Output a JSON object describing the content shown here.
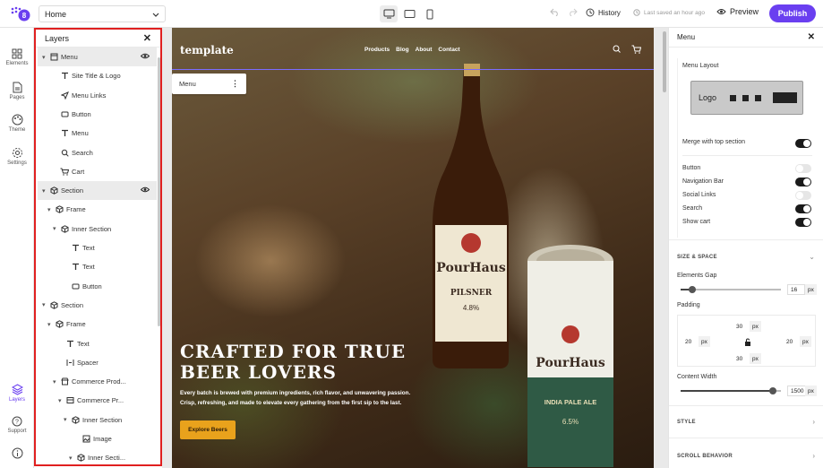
{
  "topbar": {
    "page_selector": "Home",
    "history_label": "History",
    "saved_status": "Last saved an hour ago",
    "preview_label": "Preview",
    "publish_label": "Publish",
    "accent_color": "#6a3ff0"
  },
  "rail": {
    "items": [
      {
        "label": "Elements",
        "icon": "grid-icon"
      },
      {
        "label": "Pages",
        "icon": "document-icon"
      },
      {
        "label": "Theme",
        "icon": "palette-icon"
      },
      {
        "label": "Settings",
        "icon": "gear-icon"
      },
      {
        "label": "Layers",
        "icon": "layers-icon"
      },
      {
        "label": "Support",
        "icon": "help-icon"
      }
    ]
  },
  "layers": {
    "title": "Layers",
    "items": [
      {
        "label": "Menu",
        "icon": "menu-box-icon",
        "chevron": "▾",
        "highlight": true,
        "eye": true
      },
      {
        "label": "Site Title & Logo",
        "icon": "text-icon"
      },
      {
        "label": "Menu Links",
        "icon": "send-icon"
      },
      {
        "label": "Button",
        "icon": "button-icon"
      },
      {
        "label": "Menu",
        "icon": "text-icon"
      },
      {
        "label": "Search",
        "icon": "search-icon"
      },
      {
        "label": "Cart",
        "icon": "cart-icon"
      },
      {
        "label": "Section",
        "icon": "cube-icon",
        "chevron": "▾",
        "highlight": true,
        "eye": true
      },
      {
        "label": "Frame",
        "icon": "cube-icon",
        "chevron": "▾"
      },
      {
        "label": "Inner Section",
        "icon": "cube-icon",
        "chevron": "▾"
      },
      {
        "label": "Text",
        "icon": "text-icon"
      },
      {
        "label": "Text",
        "icon": "text-icon"
      },
      {
        "label": "Button",
        "icon": "button-icon"
      },
      {
        "label": "Section",
        "icon": "cube-icon",
        "chevron": "▾"
      },
      {
        "label": "Frame",
        "icon": "cube-icon",
        "chevron": "▾"
      },
      {
        "label": "Text",
        "icon": "text-icon"
      },
      {
        "label": "Spacer",
        "icon": "spacer-icon"
      },
      {
        "label": "Commerce Prod...",
        "icon": "store-icon",
        "chevron": "▾"
      },
      {
        "label": "Commerce Pr...",
        "icon": "product-icon",
        "chevron": "▾"
      },
      {
        "label": "Inner Section",
        "icon": "cube-icon",
        "chevron": "▾"
      },
      {
        "label": "Image",
        "icon": "image-icon"
      },
      {
        "label": "Inner Secti...",
        "icon": "cube-icon",
        "chevron": "▾"
      }
    ]
  },
  "canvas": {
    "site_logo": "template",
    "nav_links": [
      "Products",
      "Blog",
      "About",
      "Contact"
    ],
    "menu_chip_label": "Menu",
    "hero_title": "CRAFTED FOR TRUE BEER LOVERS",
    "hero_body": "Every batch is brewed with premium ingredients, rich flavor, and unwavering passion. Crisp, refreshing, and made to elevate every gathering from the first sip to the last.",
    "hero_cta": "Explore Beers",
    "bottle_brand": "PourHaus",
    "bottle_type": "PILSNER",
    "bottle_abv": "4.8%",
    "can_brand": "PourHaus",
    "can_type": "INDIA PALE ALE",
    "can_abv": "6.5%"
  },
  "rpanel": {
    "title": "Menu",
    "menu_layout_label": "Menu Layout",
    "layout_logo": "Logo",
    "merge_label": "Merge with top section",
    "toggles": [
      {
        "label": "Button",
        "on": false
      },
      {
        "label": "Navigation Bar",
        "on": true
      },
      {
        "label": "Social Links",
        "on": false
      },
      {
        "label": "Search",
        "on": true
      },
      {
        "label": "Show cart",
        "on": true
      }
    ],
    "size_spacing": "SIZE & SPACE",
    "elements_gap_label": "Elements Gap",
    "elements_gap_value": "16",
    "elements_gap_fraction": 0.12,
    "padding_label": "Padding",
    "padding": {
      "top": "30",
      "right": "20",
      "bottom": "30",
      "left": "20"
    },
    "unit": "px",
    "content_width_label": "Content Width",
    "content_width_value": "1500",
    "content_width_fraction": 0.92,
    "style_label": "STYLE",
    "scroll_label": "SCROLL BEHAVIOR"
  }
}
